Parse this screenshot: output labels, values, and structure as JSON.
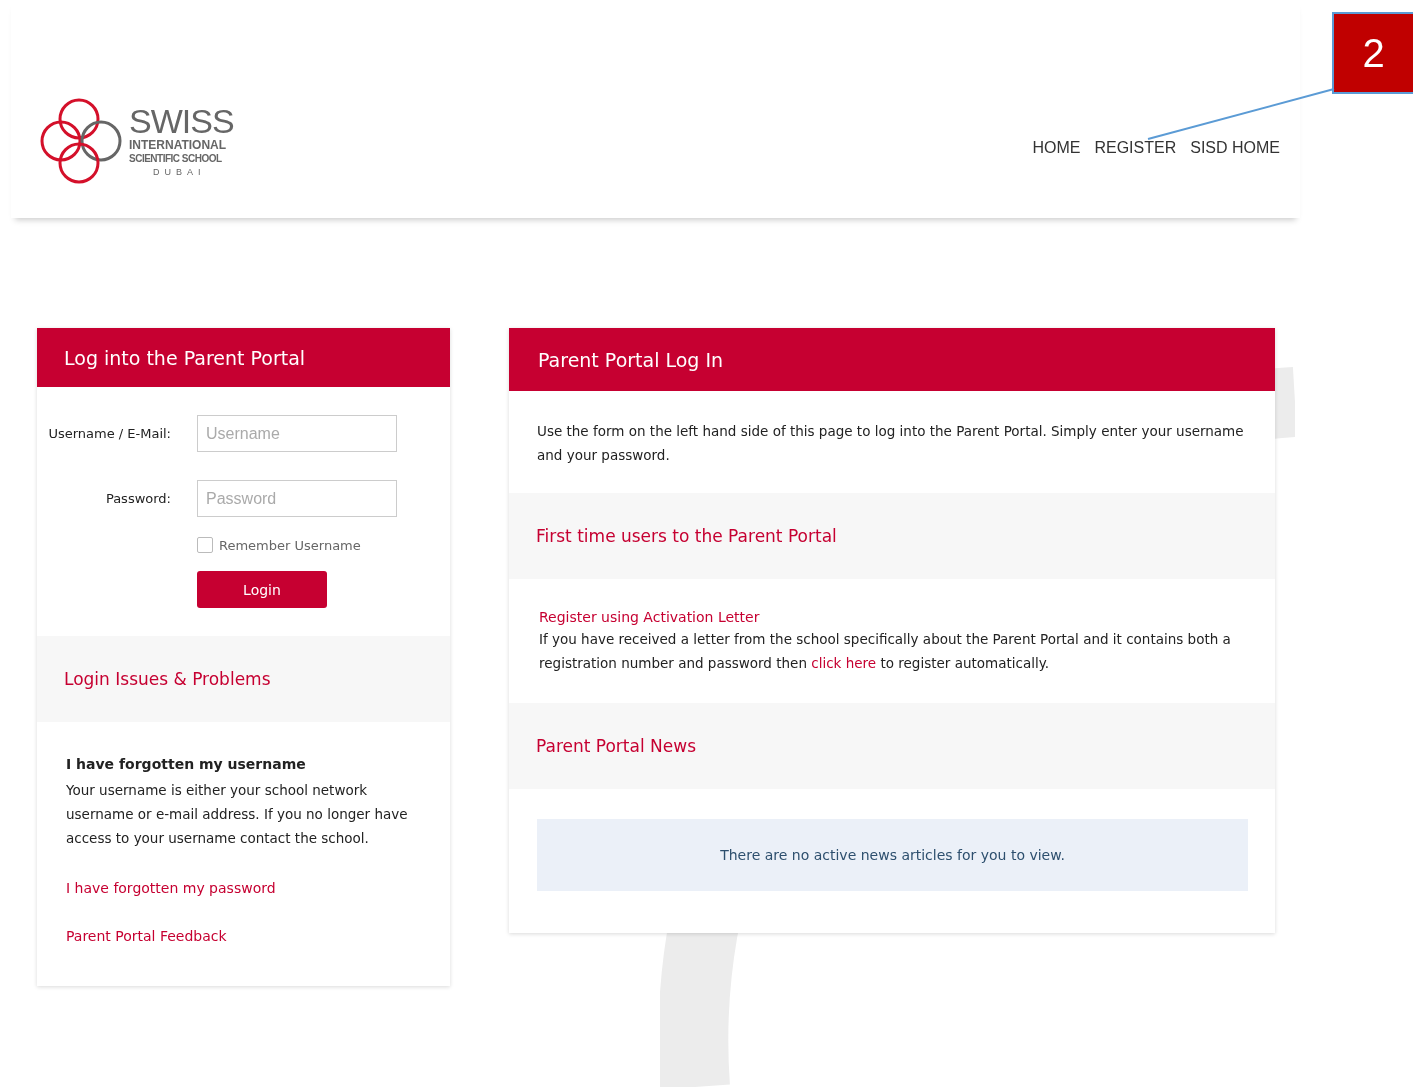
{
  "logo": {
    "name": "SWISS",
    "line_1": "INTERNATIONAL",
    "line_2": "SCIENTIFIC SCHOOL",
    "line_3": "DUBAI"
  },
  "nav": [
    {
      "label": "HOME"
    },
    {
      "label": "REGISTER"
    },
    {
      "label": "SISD HOME"
    }
  ],
  "annotation": {
    "number": "2"
  },
  "login_card": {
    "title": "Log into the Parent Portal",
    "fields": [
      {
        "label": "Username / E-Mail:",
        "placeholder": "Username"
      },
      {
        "label": "Password:",
        "placeholder": "Password"
      }
    ],
    "remember": {
      "label": "Remember Username",
      "checked": false
    },
    "button": "Login",
    "issues_title": "Login Issues & Problems",
    "forgot_heading": "I have forgotten my username",
    "forgot_text": "Your username is either your school network username or e-mail address. If you no longer have access to your username contact the school.",
    "links": [
      "I have forgotten my password",
      "Parent Portal Feedback"
    ]
  },
  "info_card": {
    "title": "Parent Portal Log In",
    "intro": "Use the form on the left hand side of this page to log into the Parent Portal. Simply enter your username and your password.",
    "first_time_title": "First time users to the Parent Portal",
    "register_link": "Register using Activation Letter",
    "register_text_before": "If you have received a letter from the school specifically about the Parent Portal and it contains both a registration number and password then",
    "register_link_inline": "click here",
    "register_text_after": "to register automatically.",
    "news_title": "Parent Portal News",
    "news_empty": "There are no active news articles for you to view."
  }
}
